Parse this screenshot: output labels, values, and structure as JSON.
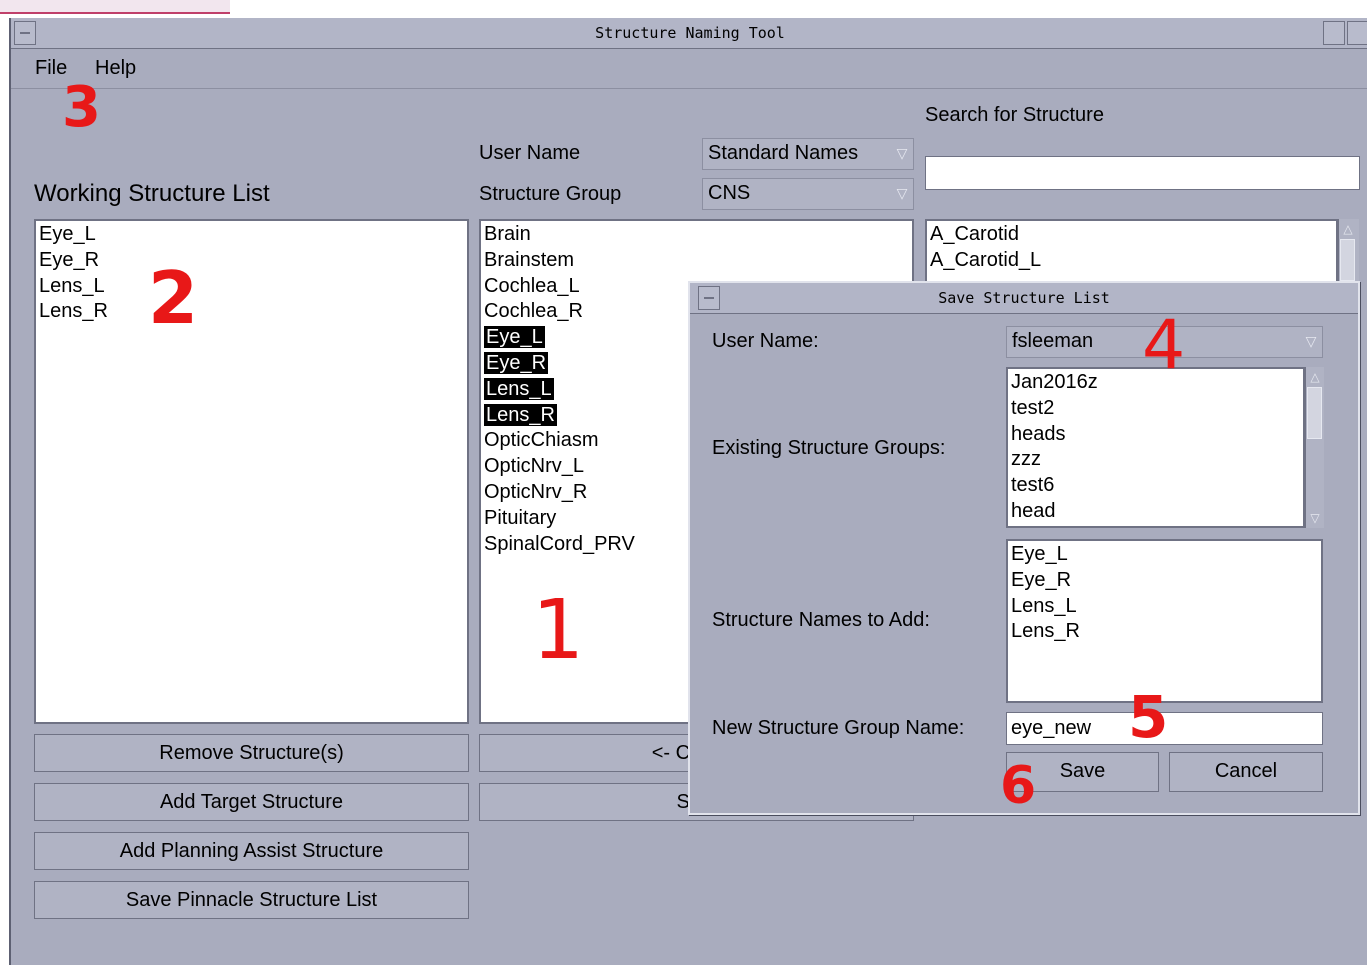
{
  "window": {
    "title": "Structure Naming Tool"
  },
  "menu": {
    "file": "File",
    "help": "Help"
  },
  "left": {
    "heading": "Working Structure List",
    "items": [
      "Eye_L",
      "Eye_R",
      "Lens_L",
      "Lens_R"
    ],
    "buttons": [
      "Remove Structure(s)",
      "Add Target Structure",
      "Add Planning Assist Structure",
      "Save Pinnacle Structure List"
    ]
  },
  "middle": {
    "user_name_label": "User Name",
    "user_name_value": "Standard Names",
    "group_label": "Structure Group",
    "group_value": "CNS",
    "items": [
      {
        "label": "Brain",
        "selected": false
      },
      {
        "label": "Brainstem",
        "selected": false
      },
      {
        "label": "Cochlea_L",
        "selected": false
      },
      {
        "label": "Cochlea_R",
        "selected": false
      },
      {
        "label": "Eye_L",
        "selected": true
      },
      {
        "label": "Eye_R",
        "selected": true
      },
      {
        "label": "Lens_L",
        "selected": true
      },
      {
        "label": "Lens_R",
        "selected": true
      },
      {
        "label": "OpticChiasm",
        "selected": false
      },
      {
        "label": "OpticNrv_L",
        "selected": false
      },
      {
        "label": "OpticNrv_R",
        "selected": false
      },
      {
        "label": "Pituitary",
        "selected": false
      },
      {
        "label": "SpinalCord_PRV",
        "selected": false
      }
    ],
    "copy_button": "<- Copy S",
    "select_button": "Sele"
  },
  "right": {
    "search_label": "Search for Structure",
    "search_value": "",
    "items": [
      "A_Carotid",
      "A_Carotid_L"
    ]
  },
  "dialog": {
    "title": "Save Structure List",
    "user_name_label": "User Name:",
    "user_name_value": "fsleeman",
    "existing_label": "Existing Structure Groups:",
    "existing_items": [
      "Jan2016z",
      "test2",
      "heads",
      "zzz",
      "test6",
      "head"
    ],
    "names_label": "Structure Names to Add:",
    "names_items": [
      "Eye_L",
      "Eye_R",
      "Lens_L",
      "Lens_R"
    ],
    "new_group_label": "New Structure Group Name:",
    "new_group_value": "eye_new",
    "save": "Save",
    "cancel": "Cancel"
  },
  "annotations": [
    "3",
    "2",
    "1",
    "4",
    "5",
    "6"
  ]
}
